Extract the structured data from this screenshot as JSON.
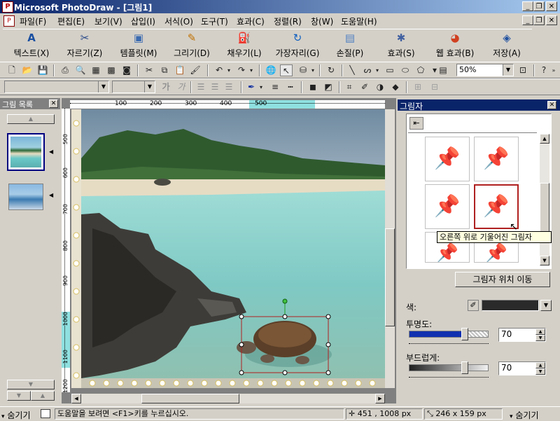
{
  "window": {
    "title": "Microsoft PhotoDraw - [그림1]",
    "app_icon": "photodraw-app-icon"
  },
  "menu": [
    "파일(F)",
    "편집(E)",
    "보기(V)",
    "삽입(I)",
    "서식(O)",
    "도구(T)",
    "효과(C)",
    "정렬(R)",
    "창(W)",
    "도움말(H)"
  ],
  "big_toolbar": [
    {
      "label": "텍스트(X)",
      "icon": "text-A-icon"
    },
    {
      "label": "자르기(Z)",
      "icon": "scissors-icon"
    },
    {
      "label": "템플릿(M)",
      "icon": "template-icon"
    },
    {
      "label": "그리기(D)",
      "icon": "pen-icon"
    },
    {
      "label": "채우기(L)",
      "icon": "paint-bucket-icon"
    },
    {
      "label": "가장자리(G)",
      "icon": "edges-icon"
    },
    {
      "label": "손질(P)",
      "icon": "touch-up-icon"
    },
    {
      "label": "효과(S)",
      "icon": "effects-icon"
    },
    {
      "label": "웹 효과(B)",
      "icon": "web-effects-icon"
    },
    {
      "label": "저장(A)",
      "icon": "save-icon"
    }
  ],
  "zoom": {
    "value": "50%"
  },
  "font_combo": {
    "value": ""
  },
  "size_combo": {
    "value": ""
  },
  "picture_list": {
    "title": "그림 목록",
    "thumbnail_count": 2
  },
  "ruler": {
    "h_ticks": [
      "100",
      "200",
      "300",
      "400",
      "500"
    ],
    "v_ticks": [
      "500",
      "600",
      "700",
      "800",
      "900",
      "1000",
      "1100",
      "1200"
    ]
  },
  "shadow_panel": {
    "title": "그림자",
    "tooltip": "오른쪽 위로 기울어진 그림자",
    "move_button": "그림자 위치 이동",
    "color_label": "색:",
    "opacity_label": "투명도:",
    "opacity_value": "70",
    "opacity_level": 0.7,
    "softness_label": "부드럽게:",
    "softness_value": "70",
    "softness_level": 0.7
  },
  "status": {
    "hide_left": "숨기기",
    "help_text": "도움말을 보려면 <F1>키를 누르십시오.",
    "position": "451 , 1008 px",
    "size": "246 x 159 px",
    "hide_right": "숨기기"
  },
  "colors": {
    "title_bar": "#0a246a",
    "selection": "#b02020",
    "sea": "#7fc9c4",
    "sky": "#c8d4dc"
  }
}
